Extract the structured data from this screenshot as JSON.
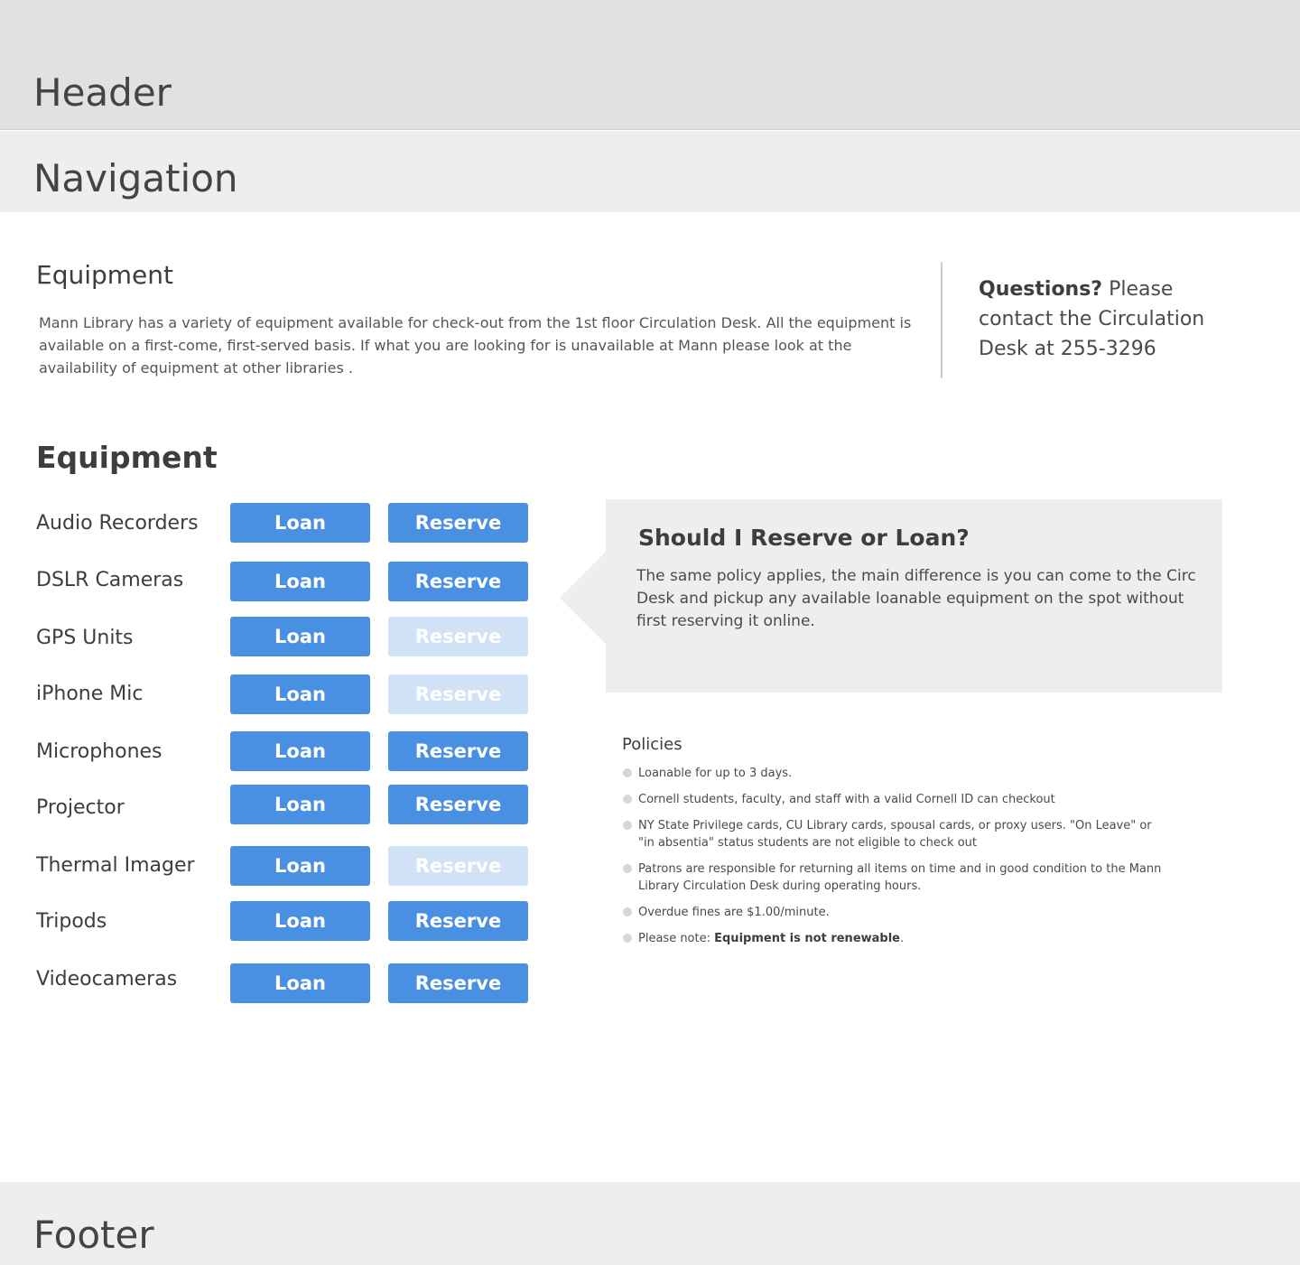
{
  "header": {
    "label": "Header"
  },
  "navigation": {
    "label": "Navigation"
  },
  "intro": {
    "title": "Equipment",
    "text": "Mann Library has a variety of equipment available for check-out from the 1st floor Circulation Desk. All the equipment is available on a first-come, first-served basis. If what you are looking for is unavailable at Mann please look at the availability of equipment at other libraries ."
  },
  "questions": {
    "bold": "Questions?",
    "text": " Please contact the Circulation Desk at 255-3296"
  },
  "equipment": {
    "title": "Equipment",
    "items": [
      {
        "name": "Audio Recorders",
        "loan": "Loan",
        "reserve": "Reserve",
        "reserve_enabled": true
      },
      {
        "name": "DSLR Cameras",
        "loan": "Loan",
        "reserve": "Reserve",
        "reserve_enabled": true
      },
      {
        "name": "GPS Units",
        "loan": "Loan",
        "reserve": "Reserve",
        "reserve_enabled": false
      },
      {
        "name": "iPhone Mic",
        "loan": "Loan",
        "reserve": "Reserve",
        "reserve_enabled": false
      },
      {
        "name": "Microphones",
        "loan": "Loan",
        "reserve": "Reserve",
        "reserve_enabled": true
      },
      {
        "name": "Projector",
        "loan": "Loan",
        "reserve": "Reserve",
        "reserve_enabled": true
      },
      {
        "name": "Thermal Imager",
        "loan": "Loan",
        "reserve": "Reserve",
        "reserve_enabled": false
      },
      {
        "name": "Tripods",
        "loan": "Loan",
        "reserve": "Reserve",
        "reserve_enabled": true
      },
      {
        "name": "Videocameras",
        "loan": "Loan",
        "reserve": "Reserve",
        "reserve_enabled": true
      }
    ]
  },
  "callout": {
    "title": "Should I Reserve or Loan?",
    "text": "The same policy applies, the main difference is you can come to the Circ Desk and pickup any available loanable equipment on the spot without first reserving it online."
  },
  "policies": {
    "title": "Policies",
    "items": [
      {
        "text": "Loanable for up to 3 days."
      },
      {
        "text": "Cornell students, faculty, and staff with a valid Cornell ID can checkout"
      },
      {
        "text": "NY State Privilege cards, CU Library cards, spousal cards, or proxy users. \"On Leave\" or \"in absentia\" status students are not eligible to check out"
      },
      {
        "text": "Patrons are responsible for returning all items on time and in good condition to the Mann Library Circulation Desk during operating hours."
      },
      {
        "text": "Overdue fines are $1.00/minute."
      },
      {
        "text": "Please note: ",
        "bold": "Equipment is not renewable",
        "after": "."
      }
    ]
  },
  "footer": {
    "label": "Footer"
  },
  "colors": {
    "button": "#4a90e2",
    "button_disabled": "#d1e2f7",
    "header_bg": "#e1e1e1",
    "nav_bg": "#eeeeee",
    "callout_bg": "#eeeeee"
  }
}
